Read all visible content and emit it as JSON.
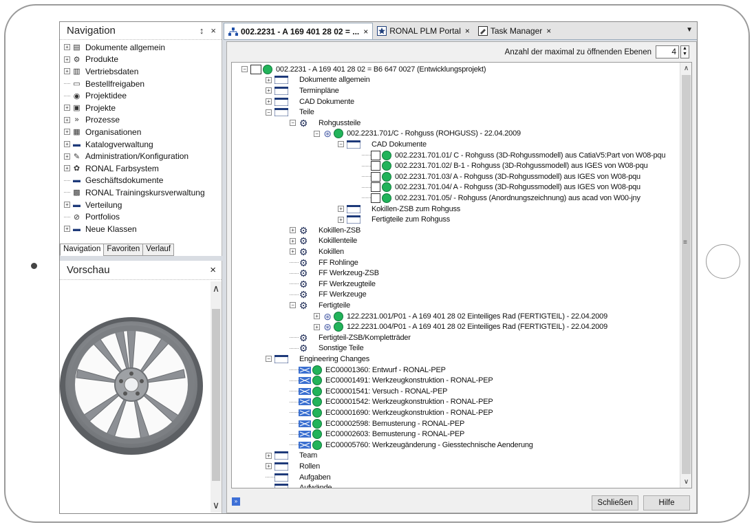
{
  "navigation": {
    "title": "Navigation",
    "pin_glyph": "↕",
    "close_glyph": "×",
    "items": [
      {
        "label": "Dokumente allgemein",
        "icon": "document-icon",
        "expandable": true
      },
      {
        "label": "Produkte",
        "icon": "gears-icon",
        "expandable": true
      },
      {
        "label": "Vertriebsdaten",
        "icon": "sales-icon",
        "expandable": true
      },
      {
        "label": "Bestellfreigaben",
        "icon": "clipboard-icon",
        "expandable": false
      },
      {
        "label": "Projektidee",
        "icon": "idea-icon",
        "expandable": false
      },
      {
        "label": "Projekte",
        "icon": "project-icon",
        "expandable": true
      },
      {
        "label": "Prozesse",
        "icon": "process-icon",
        "expandable": true
      },
      {
        "label": "Organisationen",
        "icon": "organisation-icon",
        "expandable": true
      },
      {
        "label": "Katalogverwaltung",
        "icon": "folder-icon",
        "expandable": true
      },
      {
        "label": "Administration/Konfiguration",
        "icon": "admin-icon",
        "expandable": true
      },
      {
        "label": "RONAL Farbsystem",
        "icon": "palette-icon",
        "expandable": true
      },
      {
        "label": "Geschäftsdokumente",
        "icon": "folder-icon",
        "expandable": false
      },
      {
        "label": "RONAL Trainingskursverwaltung",
        "icon": "training-icon",
        "expandable": false
      },
      {
        "label": "Verteilung",
        "icon": "folder-icon",
        "expandable": true
      },
      {
        "label": "Portfolios",
        "icon": "portfolio-icon",
        "expandable": false
      },
      {
        "label": "Neue Klassen",
        "icon": "folder-icon",
        "expandable": true
      }
    ],
    "tabs": [
      "Navigation",
      "Favoriten",
      "Verlauf"
    ]
  },
  "preview": {
    "title": "Vorschau",
    "close_glyph": "×",
    "scroll_up": "∧",
    "scroll_down": "∨"
  },
  "tabs": [
    {
      "label": "002.2231 - A 169 401 28 02 = ...",
      "active": true,
      "icon": "structure-icon"
    },
    {
      "label": "RONAL PLM Portal",
      "active": false,
      "icon": "star-icon"
    },
    {
      "label": "Task Manager",
      "active": false,
      "icon": "task-icon"
    }
  ],
  "tab_close_glyph": "×",
  "tab_dropdown_glyph": "▼",
  "levels": {
    "label": "Anzahl der maximal zu öffnenden Ebenen",
    "value": "4"
  },
  "tree": [
    {
      "depth": 0,
      "type": "root",
      "expander": "minus",
      "label": "002.2231 - A 169 401 28 02 = B6 647 0027 (Entwicklungsprojekt)"
    },
    {
      "depth": 1,
      "type": "folder",
      "expander": "plus",
      "label": "Dokumente allgemein"
    },
    {
      "depth": 1,
      "type": "folder",
      "expander": "plus",
      "label": "Terminpläne"
    },
    {
      "depth": 1,
      "type": "folder",
      "expander": "plus",
      "label": "CAD Dokumente"
    },
    {
      "depth": 1,
      "type": "folder",
      "expander": "minus",
      "label": "Teile"
    },
    {
      "depth": 2,
      "type": "gear",
      "expander": "minus",
      "label": "Rohgussteile"
    },
    {
      "depth": 3,
      "type": "part",
      "expander": "minus",
      "label": "002.2231.701/C -  Rohguss (ROHGUSS) - 22.04.2009"
    },
    {
      "depth": 4,
      "type": "folder",
      "expander": "minus",
      "label": "CAD Dokumente"
    },
    {
      "depth": 5,
      "type": "doc",
      "expander": "none",
      "label": "002.2231.701.01/ C - Rohguss (3D-Rohgussmodell) aus CatiaV5:Part von W08-pqu"
    },
    {
      "depth": 5,
      "type": "doc",
      "expander": "none",
      "label": "002.2231.701.02/ B-1 - Rohguss (3D-Rohgussmodell) aus IGES von W08-pqu"
    },
    {
      "depth": 5,
      "type": "doc",
      "expander": "none",
      "label": "002.2231.701.03/ A - Rohguss (3D-Rohgussmodell) aus IGES von W08-pqu"
    },
    {
      "depth": 5,
      "type": "doc",
      "expander": "none",
      "label": "002.2231.701.04/ A - Rohguss (3D-Rohgussmodell) aus IGES von W08-pqu"
    },
    {
      "depth": 5,
      "type": "doc",
      "expander": "none",
      "label": "002.2231.701.05/  - Rohguss (Anordnungszeichnung) aus acad von W00-jny"
    },
    {
      "depth": 4,
      "type": "folder",
      "expander": "plus",
      "label": "Kokillen-ZSB zum Rohguss"
    },
    {
      "depth": 4,
      "type": "folder",
      "expander": "plus",
      "label": "Fertigteile zum Rohguss"
    },
    {
      "depth": 2,
      "type": "gear",
      "expander": "plus",
      "label": "Kokillen-ZSB"
    },
    {
      "depth": 2,
      "type": "gear",
      "expander": "plus",
      "label": "Kokillenteile"
    },
    {
      "depth": 2,
      "type": "gear",
      "expander": "plus",
      "label": "Kokillen"
    },
    {
      "depth": 2,
      "type": "gear",
      "expander": "none",
      "label": "FF Rohlinge"
    },
    {
      "depth": 2,
      "type": "gear",
      "expander": "none",
      "label": "FF Werkzeug-ZSB"
    },
    {
      "depth": 2,
      "type": "gear",
      "expander": "none",
      "label": "FF Werkzeugteile"
    },
    {
      "depth": 2,
      "type": "gear",
      "expander": "none",
      "label": "FF Werkzeuge"
    },
    {
      "depth": 2,
      "type": "gear",
      "expander": "minus",
      "label": "Fertigteile"
    },
    {
      "depth": 3,
      "type": "part",
      "expander": "plus",
      "label": "122.2231.001/P01 - A 169 401 28 02 Einteiliges Rad (FERTIGTEIL) - 22.04.2009"
    },
    {
      "depth": 3,
      "type": "part",
      "expander": "plus",
      "label": "122.2231.004/P01 - A 169 401 28 02 Einteiliges Rad (FERTIGTEIL) - 22.04.2009"
    },
    {
      "depth": 2,
      "type": "gear",
      "expander": "none",
      "label": "Fertigteil-ZSB/Kompletträder"
    },
    {
      "depth": 2,
      "type": "gear",
      "expander": "none",
      "label": "Sonstige Teile"
    },
    {
      "depth": 1,
      "type": "folder",
      "expander": "minus",
      "label": "Engineering Changes"
    },
    {
      "depth": 2,
      "type": "ec",
      "expander": "none",
      "label": "EC00001360: Entwurf - RONAL-PEP"
    },
    {
      "depth": 2,
      "type": "ec",
      "expander": "none",
      "label": "EC00001491: Werkzeugkonstruktion - RONAL-PEP"
    },
    {
      "depth": 2,
      "type": "ec",
      "expander": "none",
      "label": "EC00001541: Versuch - RONAL-PEP"
    },
    {
      "depth": 2,
      "type": "ec",
      "expander": "none",
      "label": "EC00001542: Werkzeugkonstruktion - RONAL-PEP"
    },
    {
      "depth": 2,
      "type": "ec",
      "expander": "none",
      "label": "EC00001690: Werkzeugkonstruktion - RONAL-PEP"
    },
    {
      "depth": 2,
      "type": "ec",
      "expander": "none",
      "label": "EC00002598: Bemusterung - RONAL-PEP"
    },
    {
      "depth": 2,
      "type": "ec",
      "expander": "none",
      "label": "EC00002603: Bemusterung - RONAL-PEP"
    },
    {
      "depth": 2,
      "type": "ec",
      "expander": "none",
      "label": "EC00005760: Werkzeugänderung - Giesstechnische Aenderung"
    },
    {
      "depth": 1,
      "type": "folder",
      "expander": "plus",
      "label": "Team"
    },
    {
      "depth": 1,
      "type": "folder",
      "expander": "plus",
      "label": "Rollen"
    },
    {
      "depth": 1,
      "type": "folder",
      "expander": "none",
      "label": "Aufgaben"
    },
    {
      "depth": 1,
      "type": "folder",
      "expander": "none",
      "label": "Aufwände"
    }
  ],
  "buttons": {
    "close": "Schließen",
    "help": "Hilfe"
  },
  "bottom_glyph": "»",
  "colors": {
    "status_green": "#22b35a",
    "folder_blue": "#1e3a7a",
    "accent": "#3d6fd6"
  }
}
